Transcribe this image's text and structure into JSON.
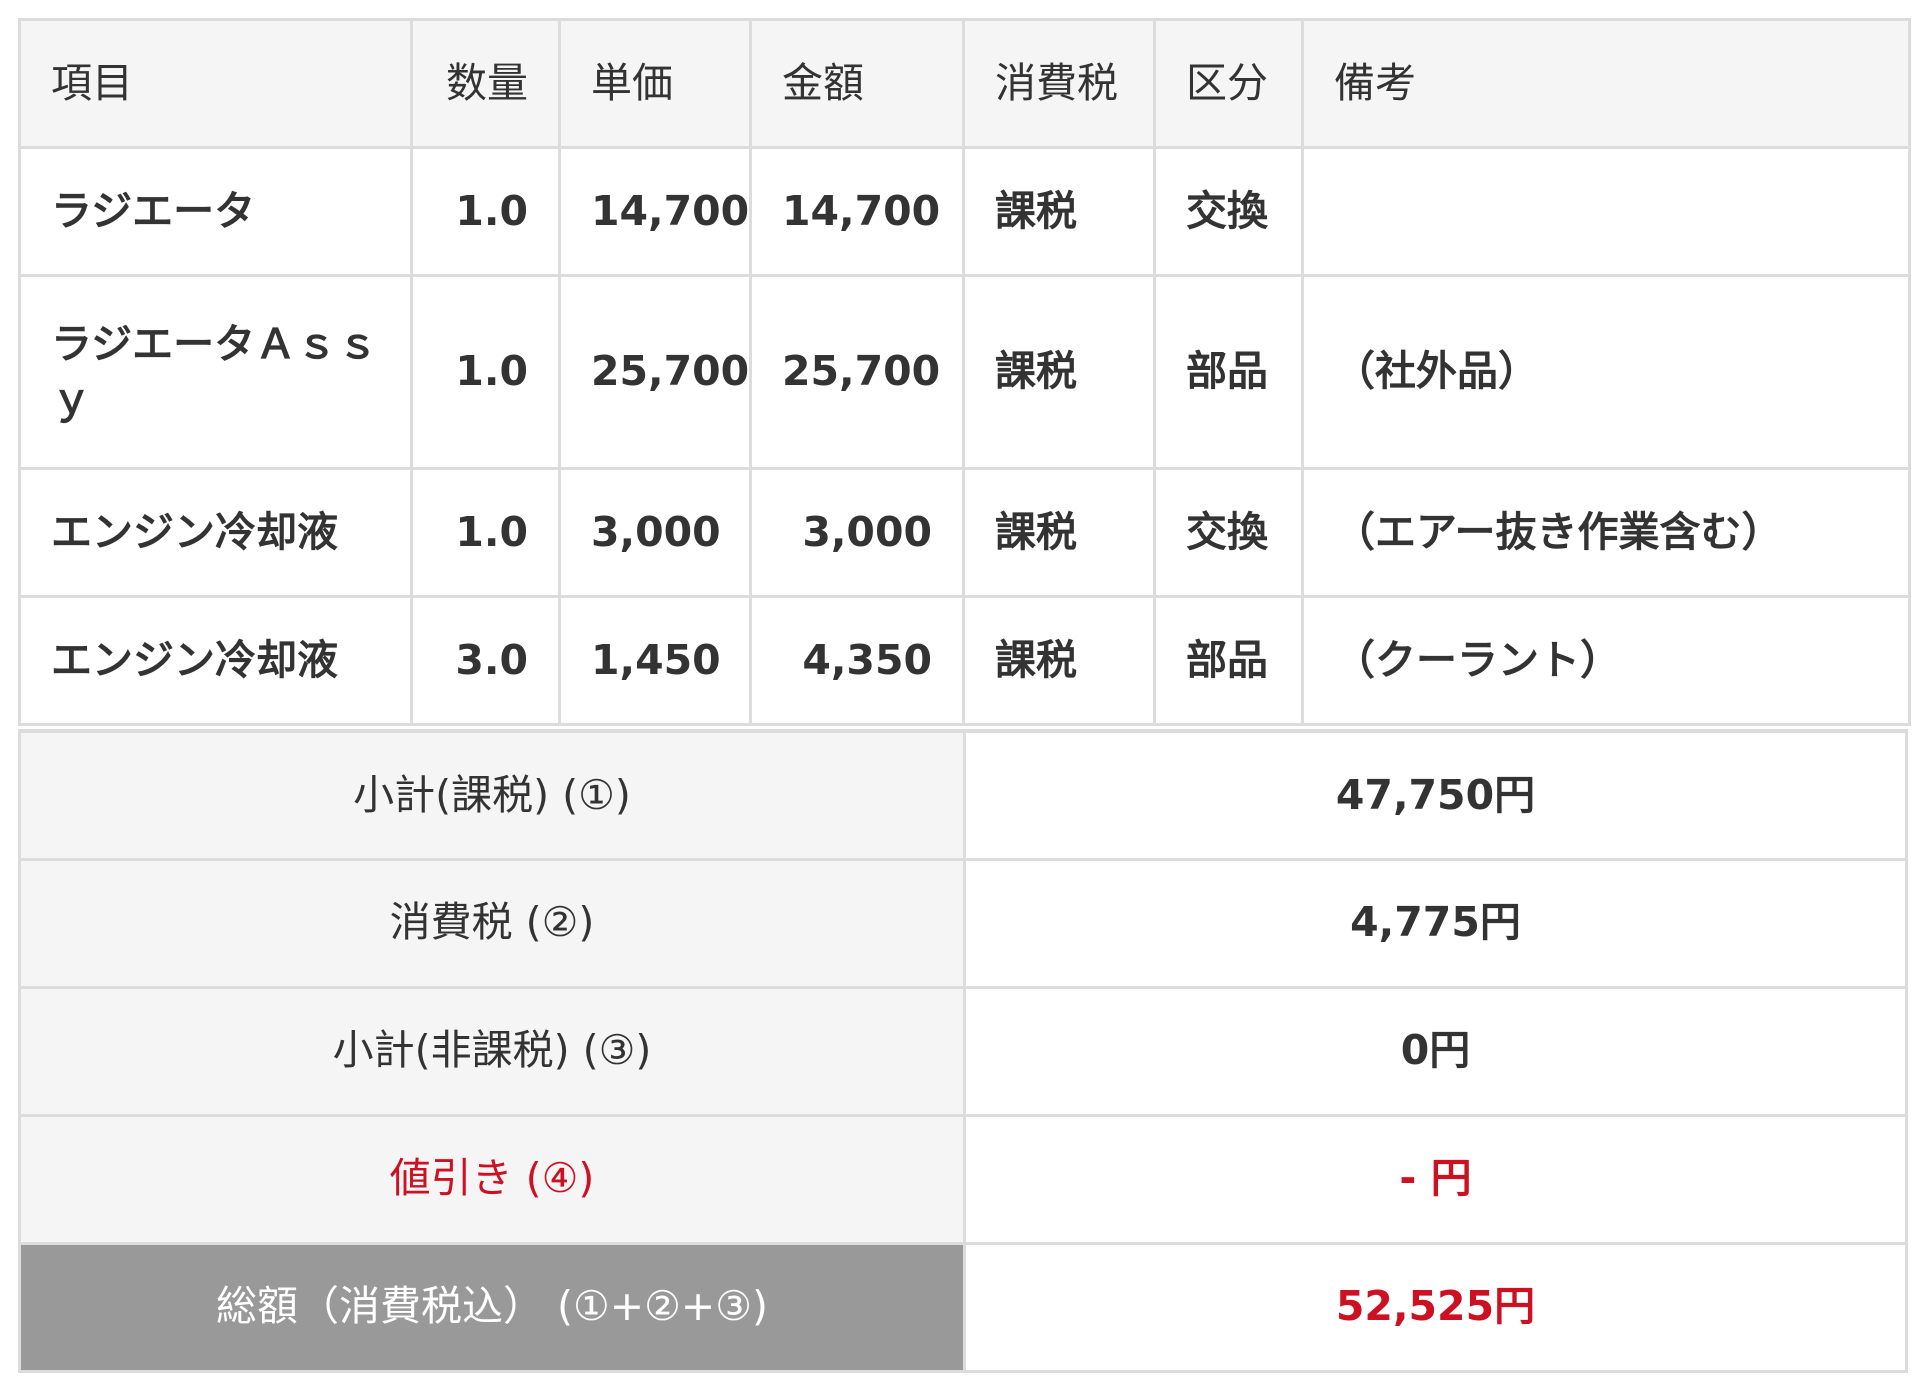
{
  "headers": {
    "item": "項目",
    "qty": "数量",
    "unit_price": "単価",
    "amount": "金額",
    "tax": "消費税",
    "category": "区分",
    "note": "備考"
  },
  "rows": [
    {
      "item": "ラジエータ",
      "qty": "1.0",
      "unit_price": "14,700",
      "amount": "14,700",
      "tax": "課税",
      "category": "交換",
      "note": ""
    },
    {
      "item": "ラジエータＡｓｓｙ",
      "qty": "1.0",
      "unit_price": "25,700",
      "amount": "25,700",
      "tax": "課税",
      "category": "部品",
      "note": "（社外品）"
    },
    {
      "item": "エンジン冷却液",
      "qty": "1.0",
      "unit_price": "3,000",
      "amount": "3,000",
      "tax": "課税",
      "category": "交換",
      "note": "（エアー抜き作業含む）"
    },
    {
      "item": "エンジン冷却液",
      "qty": "3.0",
      "unit_price": "1,450",
      "amount": "4,350",
      "tax": "課税",
      "category": "部品",
      "note": "（クーラント）"
    }
  ],
  "summary": {
    "subtotal_taxable_label": "小計(課税) (①)",
    "subtotal_taxable_value": "47,750円",
    "consumption_tax_label": "消費税 (②)",
    "consumption_tax_value": "4,775円",
    "subtotal_nontaxable_label": "小計(非課税) (③)",
    "subtotal_nontaxable_value": "0円",
    "discount_label": "値引き (④)",
    "discount_value": "- 円",
    "total_label": "総額（消費税込） (①+②+③)",
    "total_value": "52,525円"
  },
  "colors": {
    "accent_red": "#cc1122",
    "header_bg": "#f5f5f5",
    "total_label_bg": "#999999",
    "border": "#dcdcdc"
  }
}
